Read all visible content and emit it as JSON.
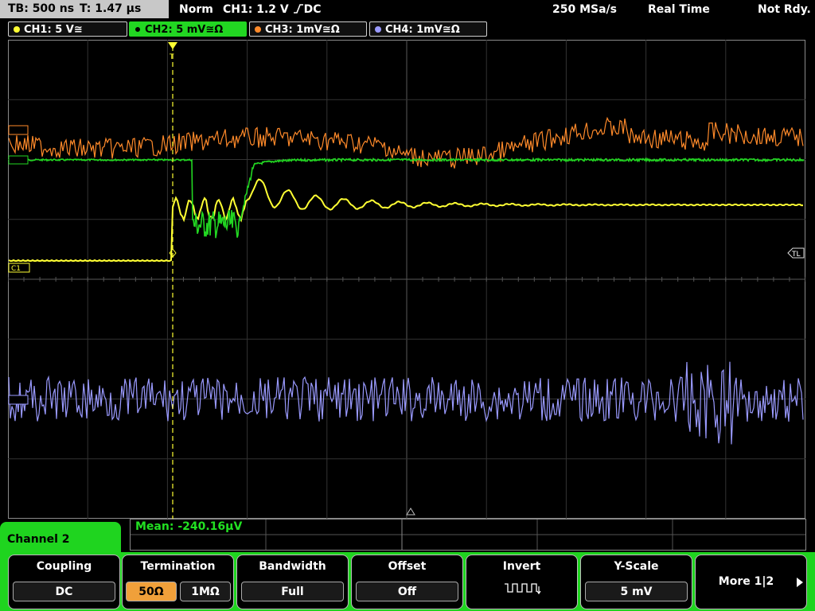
{
  "status": {
    "timebase": "TB: 500 ns",
    "trigger_time": "T: 1.47 µs",
    "mode": "Norm",
    "trigger_info": "CH1: 1.2 V",
    "trigger_coupling": "DC",
    "sample_rate": "250 MSa/s",
    "acq_mode": "Real Time",
    "ready_state": "Not Rdy."
  },
  "channels": [
    {
      "label": "CH1: 5 V≅",
      "color": "#ffff33"
    },
    {
      "label": "CH2: 5 mV≅Ω",
      "color": "#22d722"
    },
    {
      "label": "CH3: 1mV≅Ω",
      "color": "#ff8a2a"
    },
    {
      "label": "CH4: 1mV≅Ω",
      "color": "#9a9aff"
    }
  ],
  "markers": {
    "ch1": "C1",
    "trigger_level": "TL",
    "trigger_pos": "T"
  },
  "menu": {
    "title": "Channel 2",
    "measurement": "Mean: -240.16µV"
  },
  "softkeys": {
    "coupling": {
      "label": "Coupling",
      "value": "DC"
    },
    "termination": {
      "label": "Termination",
      "value_a": "50Ω",
      "value_b": "1MΩ"
    },
    "bandwidth": {
      "label": "Bandwidth",
      "value": "Full"
    },
    "offset": {
      "label": "Offset",
      "value": "Off"
    },
    "invert": {
      "label": "Invert"
    },
    "yscale": {
      "label": "Y-Scale",
      "value": "5 mV"
    },
    "more": {
      "label": "More 1|2"
    }
  }
}
